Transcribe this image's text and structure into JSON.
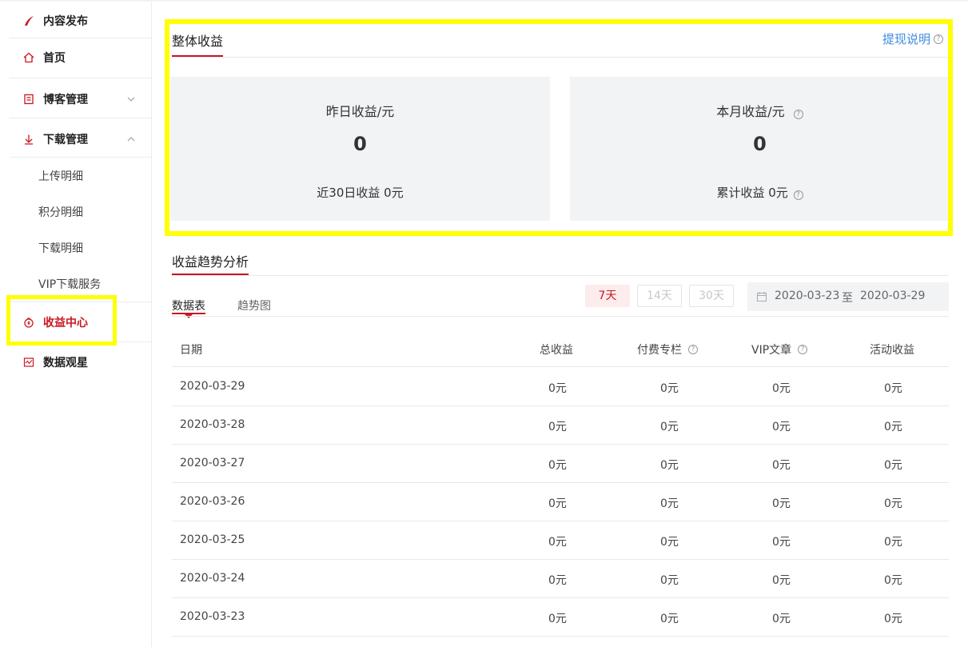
{
  "sidebar": {
    "publish_label": "内容发布",
    "home_label": "首页",
    "blog_label": "博客管理",
    "download_label": "下载管理",
    "sub_items": [
      "上传明细",
      "积分明细",
      "下载明细",
      "VIP下载服务"
    ],
    "income_label": "收益中心",
    "data_label": "数据观星"
  },
  "overview": {
    "title": "整体收益",
    "help_link": "提现说明",
    "yesterday_label": "昨日收益/元",
    "yesterday_value": "0",
    "last30_text": "近30日收益 0元",
    "month_label": "本月收益/元",
    "month_value": "0",
    "total_text": "累计收益 0元"
  },
  "trend": {
    "title": "收益趋势分析",
    "tabs": [
      "数据表",
      "趋势图"
    ],
    "ranges": [
      "7天",
      "14天",
      "30天"
    ],
    "date_start": "2020-03-23",
    "date_sep": "至",
    "date_end": "2020-03-29"
  },
  "table": {
    "headers": [
      "日期",
      "总收益",
      "付费专栏",
      "VIP文章",
      "活动收益"
    ],
    "rows": [
      [
        "2020-03-29",
        "0元",
        "0元",
        "0元",
        "0元"
      ],
      [
        "2020-03-28",
        "0元",
        "0元",
        "0元",
        "0元"
      ],
      [
        "2020-03-27",
        "0元",
        "0元",
        "0元",
        "0元"
      ],
      [
        "2020-03-26",
        "0元",
        "0元",
        "0元",
        "0元"
      ],
      [
        "2020-03-25",
        "0元",
        "0元",
        "0元",
        "0元"
      ],
      [
        "2020-03-24",
        "0元",
        "0元",
        "0元",
        "0元"
      ],
      [
        "2020-03-23",
        "0元",
        "0元",
        "0元",
        "0元"
      ]
    ]
  },
  "colors": {
    "accent": "#c91623",
    "link": "#3d8be0",
    "highlight": "#ffff00",
    "card_bg": "#f2f3f5"
  }
}
